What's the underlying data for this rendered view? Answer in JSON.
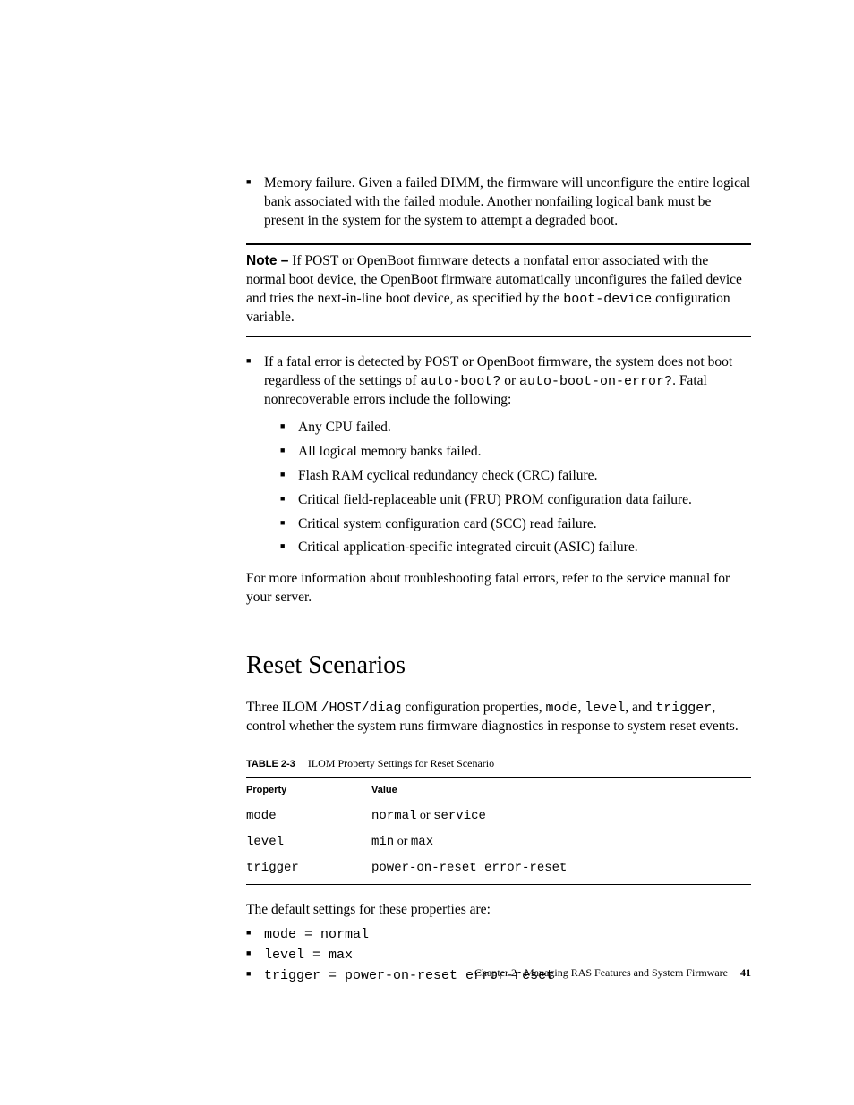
{
  "bullets_top": [
    "Memory failure. Given a failed DIMM, the firmware will unconfigure the entire logical bank associated with the failed module. Another nonfailing logical bank must be present in the system for the system to attempt a degraded boot."
  ],
  "note": {
    "label": "Note –",
    "text_pre": " If POST or OpenBoot firmware detects a nonfatal error associated with the normal boot device, the OpenBoot firmware automatically unconfigures the failed device and tries the next-in-line boot device, as specified by the ",
    "code": "boot-device",
    "text_post": " configuration variable."
  },
  "fatal": {
    "intro_pre": "If a fatal error is detected by POST or OpenBoot firmware, the system does not boot regardless of the settings of ",
    "code1": "auto-boot?",
    "mid": " or ",
    "code2": "auto-boot-on-error?",
    "intro_post": ". Fatal nonrecoverable errors include the following:",
    "items": [
      "Any CPU failed.",
      "All logical memory banks failed.",
      "Flash RAM cyclical redundancy check (CRC) failure.",
      "Critical field-replaceable unit (FRU) PROM configuration data failure.",
      "Critical system configuration card (SCC) read failure.",
      "Critical application-specific integrated circuit (ASIC) failure."
    ]
  },
  "more_info": "For more information about troubleshooting fatal errors, refer to the service manual for your server.",
  "section_heading": "Reset Scenarios",
  "reset_intro": {
    "pre": "Three ILOM ",
    "code1": "/HOST/diag",
    "mid1": " configuration properties, ",
    "code2": "mode",
    "mid2": ", ",
    "code3": "level",
    "mid3": ", and ",
    "code4": "trigger",
    "post": ", control whether the system runs firmware diagnostics in response to system reset events."
  },
  "table": {
    "label": "TABLE 2-3",
    "caption": "ILOM Property Settings for Reset Scenario",
    "headers": [
      "Property",
      "Value"
    ],
    "rows": [
      {
        "prop": "mode",
        "val_pre": "normal",
        "or": " or ",
        "val_post": "service"
      },
      {
        "prop": "level",
        "val_pre": "min",
        "or": " or ",
        "val_post": "max"
      },
      {
        "prop": "trigger",
        "val_pre": "power-on-reset error-reset",
        "or": "",
        "val_post": ""
      }
    ]
  },
  "defaults_intro": "The default settings for these properties are:",
  "defaults": [
    {
      "k": "mode",
      "eq": " = ",
      "v": "normal"
    },
    {
      "k": "level",
      "eq": " = ",
      "v": "max"
    },
    {
      "k": "trigger",
      "eq": " = ",
      "v": "power-on-reset error-reset"
    }
  ],
  "footer": {
    "chapter": "Chapter 2",
    "title": "Managing RAS Features and System Firmware",
    "page": "41"
  }
}
